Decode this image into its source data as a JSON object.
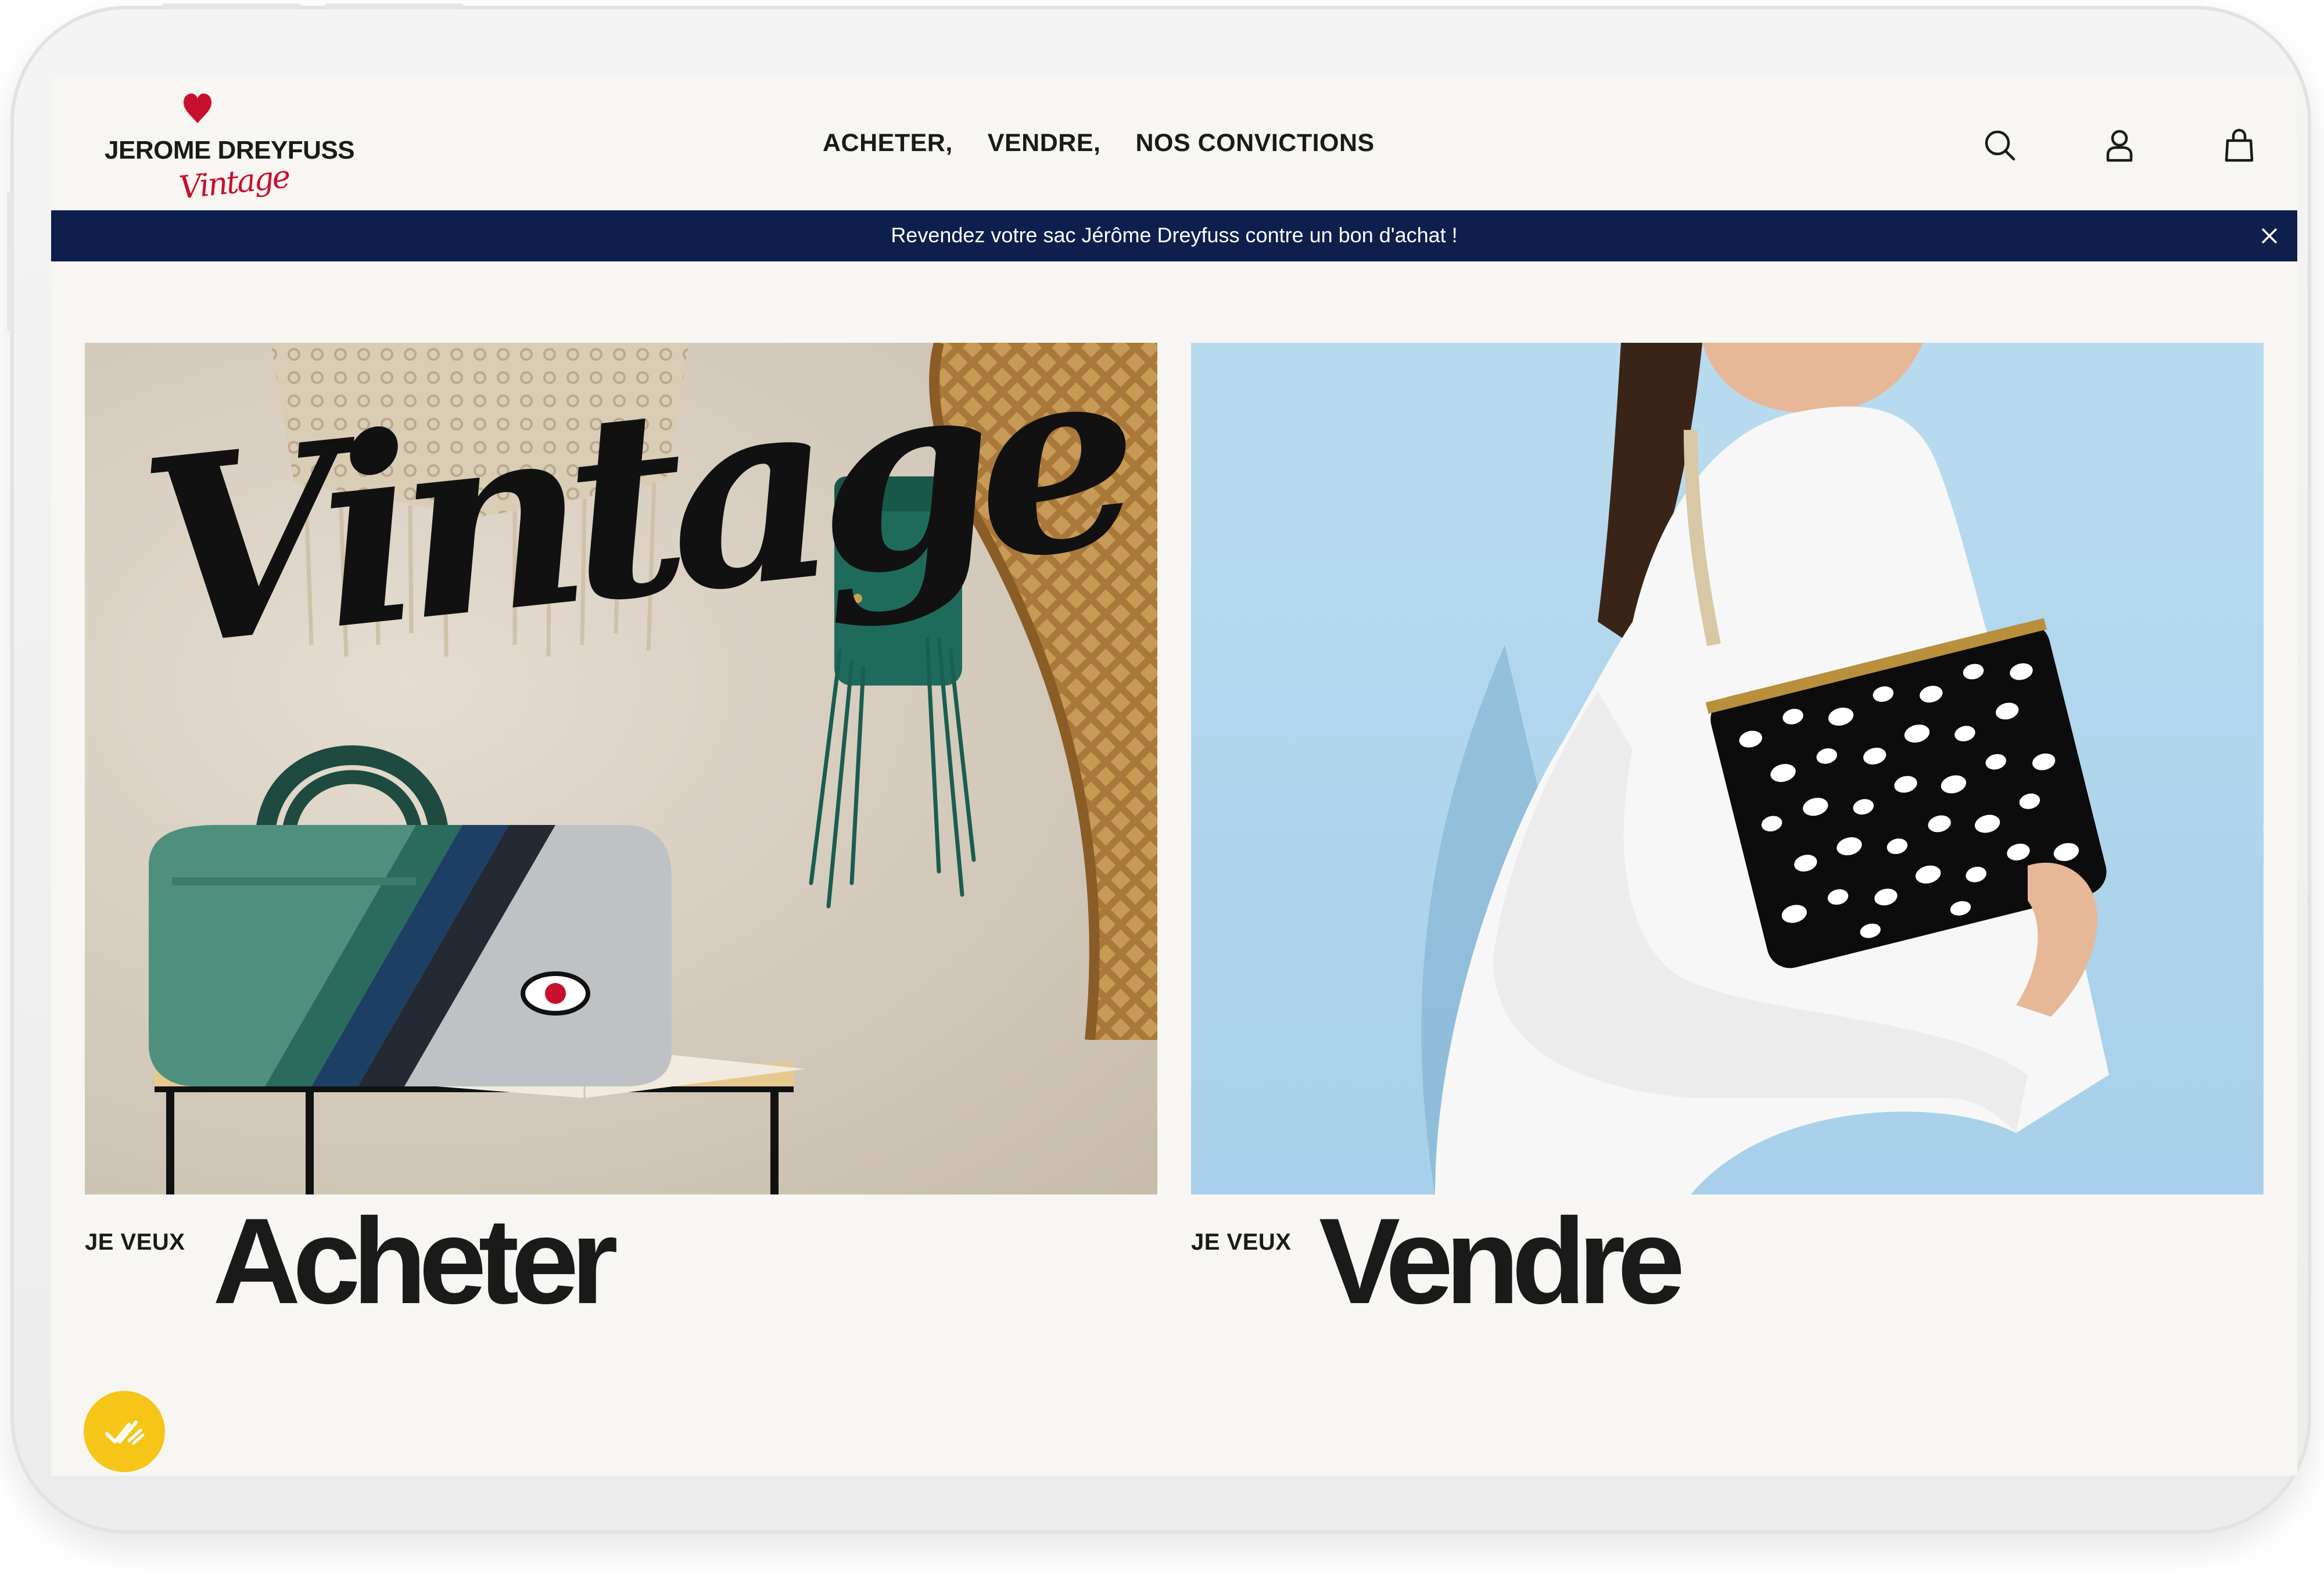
{
  "brand": {
    "name": "JEROME DREYFUSS",
    "script": "Vintage",
    "heart_color": "#c8102e"
  },
  "nav": {
    "items": [
      {
        "label": "ACHETER,"
      },
      {
        "label": "VENDRE,"
      },
      {
        "label": "NOS CONVICTIONS"
      }
    ]
  },
  "header_icons": [
    "search-icon",
    "user-icon",
    "bag-icon"
  ],
  "banner": {
    "text": "Revendez votre sac Jérôme Dreyfuss contre un bon d'achat !",
    "background": "#0e1f4d"
  },
  "cards": [
    {
      "prefix": "JE VEUX",
      "title": "Acheter"
    },
    {
      "prefix": "JE VEUX",
      "title": "Vendre"
    }
  ],
  "hero_left_overlay": "Vintage",
  "floating_badge": {
    "icon": "double-check-icon",
    "color": "#f5c518"
  }
}
